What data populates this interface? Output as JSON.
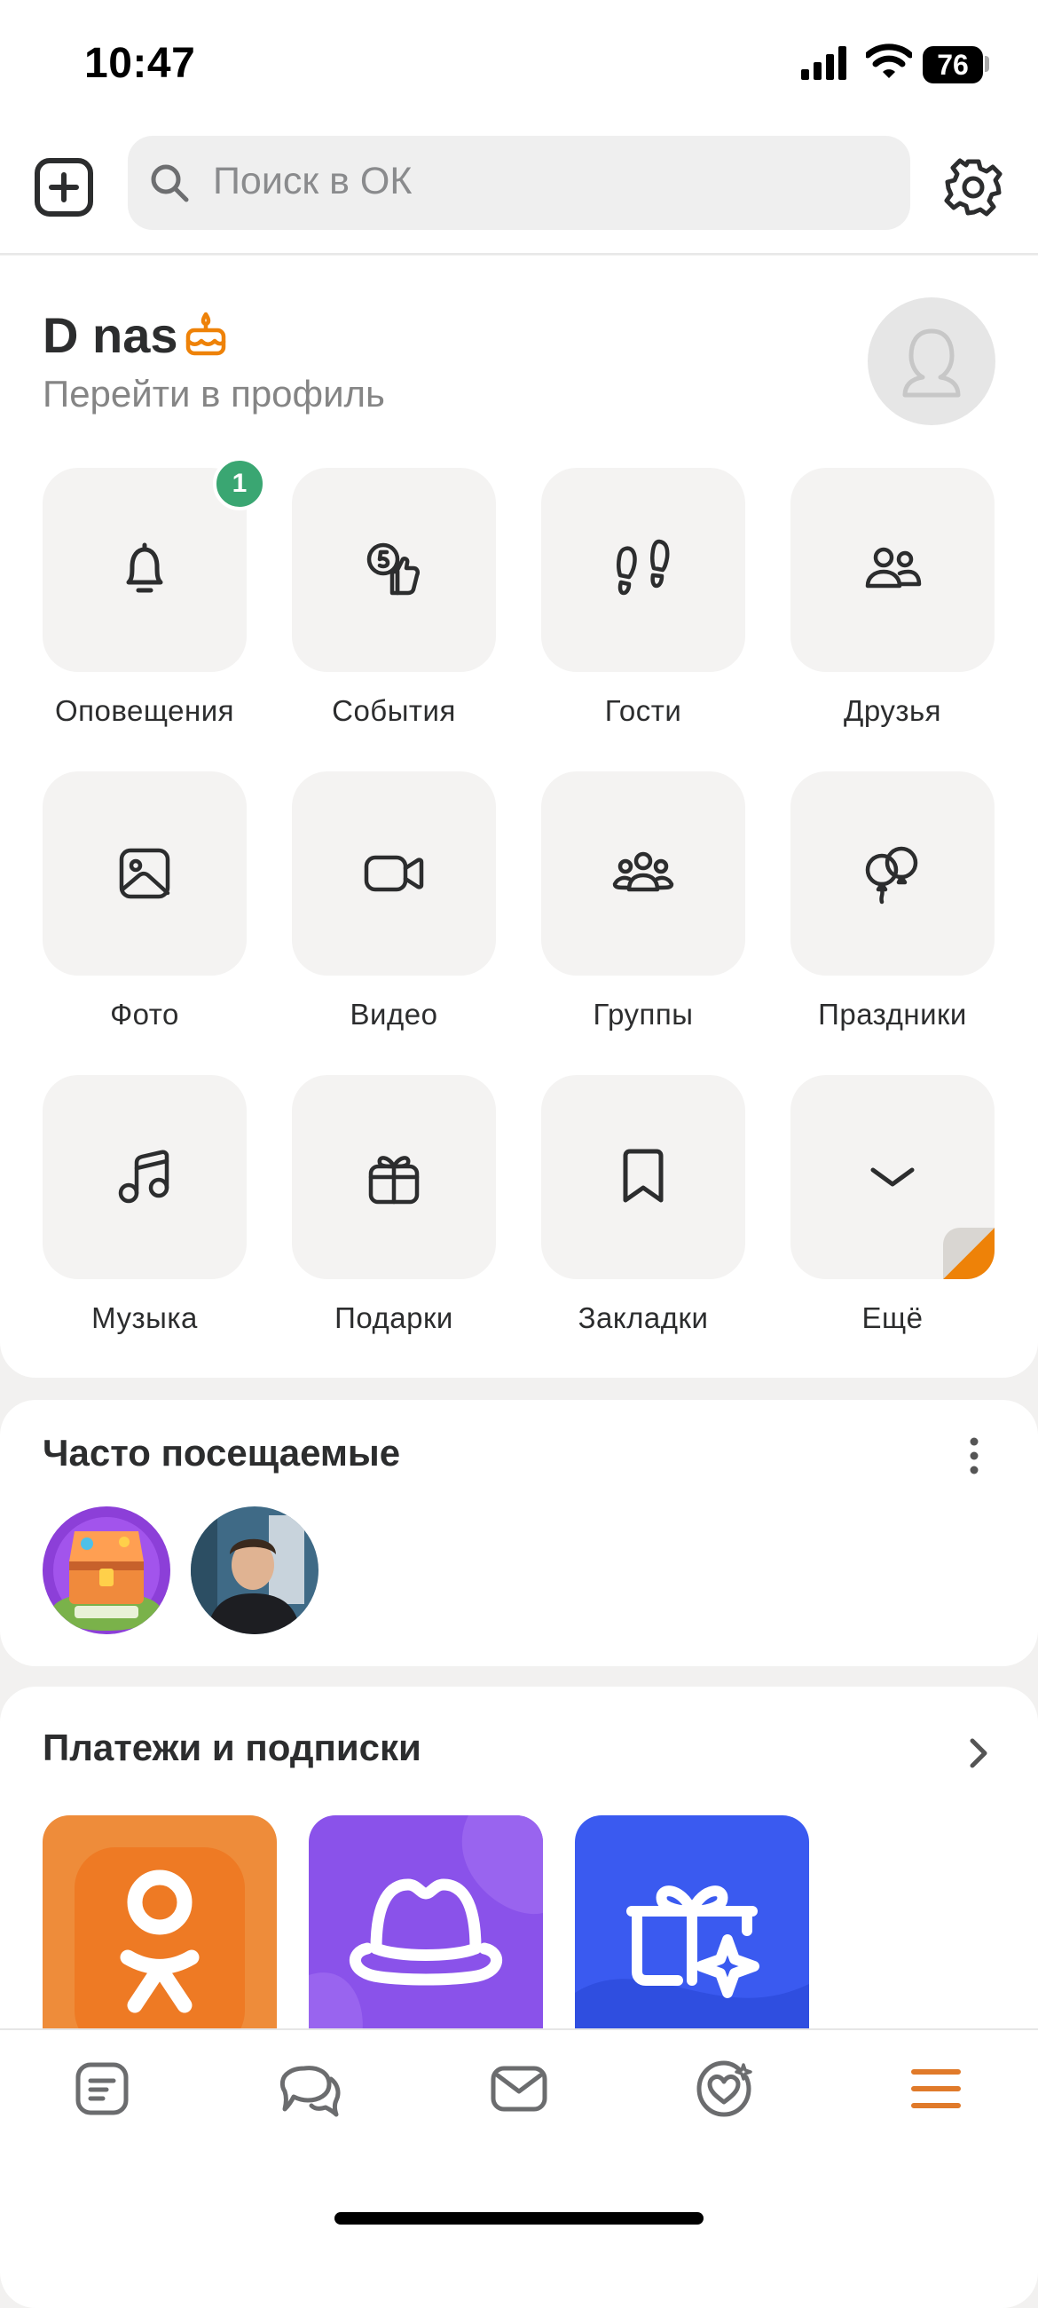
{
  "status_bar": {
    "time": "10:47",
    "battery": "76"
  },
  "header": {
    "search_placeholder": "Поиск в ОК"
  },
  "profile": {
    "name": "D nas",
    "link_label": "Перейти в профиль"
  },
  "menu_tiles": [
    {
      "label": "Оповещения",
      "icon": "bell-icon",
      "badge": "1"
    },
    {
      "label": "События",
      "icon": "events-icon"
    },
    {
      "label": "Гости",
      "icon": "footprints-icon"
    },
    {
      "label": "Друзья",
      "icon": "friends-icon"
    },
    {
      "label": "Фото",
      "icon": "photo-icon"
    },
    {
      "label": "Видео",
      "icon": "video-icon"
    },
    {
      "label": "Группы",
      "icon": "groups-icon"
    },
    {
      "label": "Праздники",
      "icon": "balloons-icon"
    },
    {
      "label": "Музыка",
      "icon": "music-icon"
    },
    {
      "label": "Подарки",
      "icon": "gift-icon"
    },
    {
      "label": "Закладки",
      "icon": "bookmark-icon"
    },
    {
      "label": "Ещё",
      "icon": "chevron-down-icon"
    }
  ],
  "frequent": {
    "title": "Часто посещаемые"
  },
  "payments": {
    "title": "Платежи и подписки"
  },
  "tabbar": [
    "feed-icon",
    "discussions-icon",
    "messages-icon",
    "dating-icon",
    "menu-icon"
  ],
  "colors": {
    "accent": "#ee8208",
    "badge": "#3aa672",
    "text": "#2c2d2e",
    "muted": "#858585"
  }
}
